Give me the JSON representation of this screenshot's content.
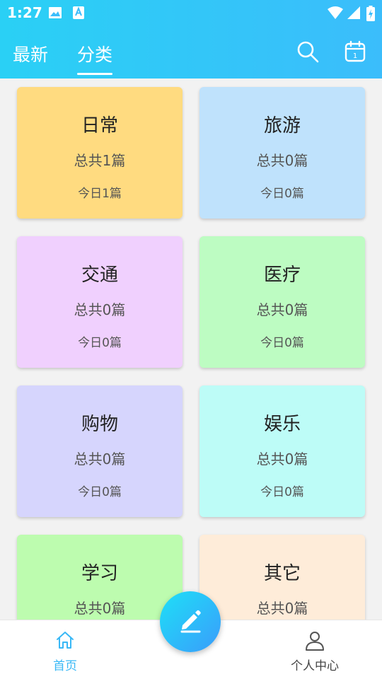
{
  "status_bar": {
    "time": "1:27"
  },
  "header": {
    "tabs": [
      {
        "label": "最新",
        "active": false
      },
      {
        "label": "分类",
        "active": true
      }
    ]
  },
  "categories": [
    {
      "title": "日常",
      "total": "总共1篇",
      "today": "今日1篇",
      "color": "#ffdb80"
    },
    {
      "title": "旅游",
      "total": "总共0篇",
      "today": "今日0篇",
      "color": "#bfe2fc"
    },
    {
      "title": "交通",
      "total": "总共0篇",
      "today": "今日0篇",
      "color": "#f0d0fe"
    },
    {
      "title": "医疗",
      "total": "总共0篇",
      "today": "今日0篇",
      "color": "#bdfcc2"
    },
    {
      "title": "购物",
      "total": "总共0篇",
      "today": "今日0篇",
      "color": "#d6d5fd"
    },
    {
      "title": "娱乐",
      "total": "总共0篇",
      "today": "今日0篇",
      "color": "#bdfcf7"
    },
    {
      "title": "学习",
      "total": "总共0篇",
      "today": "",
      "color": "#bdfcaf"
    },
    {
      "title": "其它",
      "total": "总共0篇",
      "today": "",
      "color": "#feecd9"
    }
  ],
  "bottom_nav": {
    "home": {
      "label": "首页",
      "active": true
    },
    "profile": {
      "label": "个人中心",
      "active": false
    }
  },
  "colors": {
    "accent": "#39b8f6",
    "header_start": "#2ad0f5",
    "header_end": "#3bbdfb",
    "inactive": "#555555"
  },
  "icons": {
    "status": [
      "image-icon",
      "a-notification-icon",
      "wifi-icon",
      "signal-icon",
      "battery-icon"
    ],
    "header": [
      "search-icon",
      "calendar-icon"
    ],
    "fab": "edit-pencil-icon",
    "nav": [
      "home-icon",
      "person-icon"
    ]
  }
}
